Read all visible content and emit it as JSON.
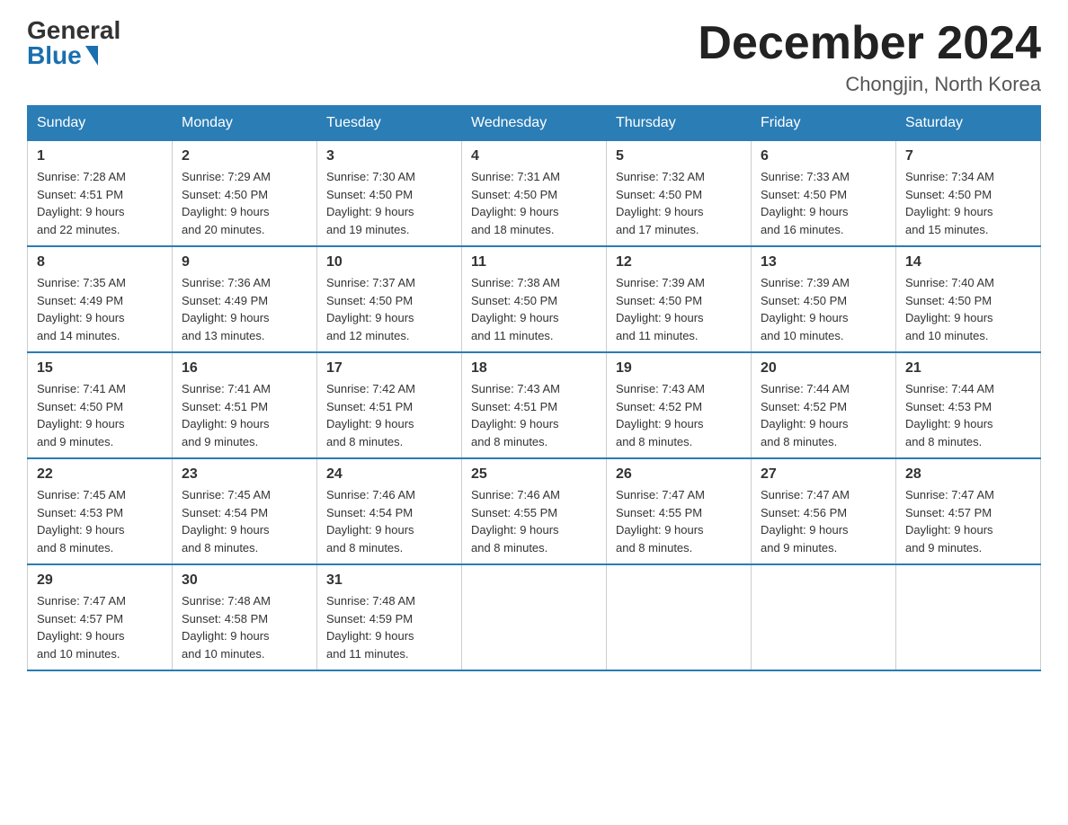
{
  "logo": {
    "general": "General",
    "blue": "Blue"
  },
  "title": "December 2024",
  "location": "Chongjin, North Korea",
  "days_of_week": [
    "Sunday",
    "Monday",
    "Tuesday",
    "Wednesday",
    "Thursday",
    "Friday",
    "Saturday"
  ],
  "weeks": [
    [
      {
        "day": "1",
        "sunrise": "7:28 AM",
        "sunset": "4:51 PM",
        "daylight": "9 hours and 22 minutes."
      },
      {
        "day": "2",
        "sunrise": "7:29 AM",
        "sunset": "4:50 PM",
        "daylight": "9 hours and 20 minutes."
      },
      {
        "day": "3",
        "sunrise": "7:30 AM",
        "sunset": "4:50 PM",
        "daylight": "9 hours and 19 minutes."
      },
      {
        "day": "4",
        "sunrise": "7:31 AM",
        "sunset": "4:50 PM",
        "daylight": "9 hours and 18 minutes."
      },
      {
        "day": "5",
        "sunrise": "7:32 AM",
        "sunset": "4:50 PM",
        "daylight": "9 hours and 17 minutes."
      },
      {
        "day": "6",
        "sunrise": "7:33 AM",
        "sunset": "4:50 PM",
        "daylight": "9 hours and 16 minutes."
      },
      {
        "day": "7",
        "sunrise": "7:34 AM",
        "sunset": "4:50 PM",
        "daylight": "9 hours and 15 minutes."
      }
    ],
    [
      {
        "day": "8",
        "sunrise": "7:35 AM",
        "sunset": "4:49 PM",
        "daylight": "9 hours and 14 minutes."
      },
      {
        "day": "9",
        "sunrise": "7:36 AM",
        "sunset": "4:49 PM",
        "daylight": "9 hours and 13 minutes."
      },
      {
        "day": "10",
        "sunrise": "7:37 AM",
        "sunset": "4:50 PM",
        "daylight": "9 hours and 12 minutes."
      },
      {
        "day": "11",
        "sunrise": "7:38 AM",
        "sunset": "4:50 PM",
        "daylight": "9 hours and 11 minutes."
      },
      {
        "day": "12",
        "sunrise": "7:39 AM",
        "sunset": "4:50 PM",
        "daylight": "9 hours and 11 minutes."
      },
      {
        "day": "13",
        "sunrise": "7:39 AM",
        "sunset": "4:50 PM",
        "daylight": "9 hours and 10 minutes."
      },
      {
        "day": "14",
        "sunrise": "7:40 AM",
        "sunset": "4:50 PM",
        "daylight": "9 hours and 10 minutes."
      }
    ],
    [
      {
        "day": "15",
        "sunrise": "7:41 AM",
        "sunset": "4:50 PM",
        "daylight": "9 hours and 9 minutes."
      },
      {
        "day": "16",
        "sunrise": "7:41 AM",
        "sunset": "4:51 PM",
        "daylight": "9 hours and 9 minutes."
      },
      {
        "day": "17",
        "sunrise": "7:42 AM",
        "sunset": "4:51 PM",
        "daylight": "9 hours and 8 minutes."
      },
      {
        "day": "18",
        "sunrise": "7:43 AM",
        "sunset": "4:51 PM",
        "daylight": "9 hours and 8 minutes."
      },
      {
        "day": "19",
        "sunrise": "7:43 AM",
        "sunset": "4:52 PM",
        "daylight": "9 hours and 8 minutes."
      },
      {
        "day": "20",
        "sunrise": "7:44 AM",
        "sunset": "4:52 PM",
        "daylight": "9 hours and 8 minutes."
      },
      {
        "day": "21",
        "sunrise": "7:44 AM",
        "sunset": "4:53 PM",
        "daylight": "9 hours and 8 minutes."
      }
    ],
    [
      {
        "day": "22",
        "sunrise": "7:45 AM",
        "sunset": "4:53 PM",
        "daylight": "9 hours and 8 minutes."
      },
      {
        "day": "23",
        "sunrise": "7:45 AM",
        "sunset": "4:54 PM",
        "daylight": "9 hours and 8 minutes."
      },
      {
        "day": "24",
        "sunrise": "7:46 AM",
        "sunset": "4:54 PM",
        "daylight": "9 hours and 8 minutes."
      },
      {
        "day": "25",
        "sunrise": "7:46 AM",
        "sunset": "4:55 PM",
        "daylight": "9 hours and 8 minutes."
      },
      {
        "day": "26",
        "sunrise": "7:47 AM",
        "sunset": "4:55 PM",
        "daylight": "9 hours and 8 minutes."
      },
      {
        "day": "27",
        "sunrise": "7:47 AM",
        "sunset": "4:56 PM",
        "daylight": "9 hours and 9 minutes."
      },
      {
        "day": "28",
        "sunrise": "7:47 AM",
        "sunset": "4:57 PM",
        "daylight": "9 hours and 9 minutes."
      }
    ],
    [
      {
        "day": "29",
        "sunrise": "7:47 AM",
        "sunset": "4:57 PM",
        "daylight": "9 hours and 10 minutes."
      },
      {
        "day": "30",
        "sunrise": "7:48 AM",
        "sunset": "4:58 PM",
        "daylight": "9 hours and 10 minutes."
      },
      {
        "day": "31",
        "sunrise": "7:48 AM",
        "sunset": "4:59 PM",
        "daylight": "9 hours and 11 minutes."
      },
      null,
      null,
      null,
      null
    ]
  ]
}
